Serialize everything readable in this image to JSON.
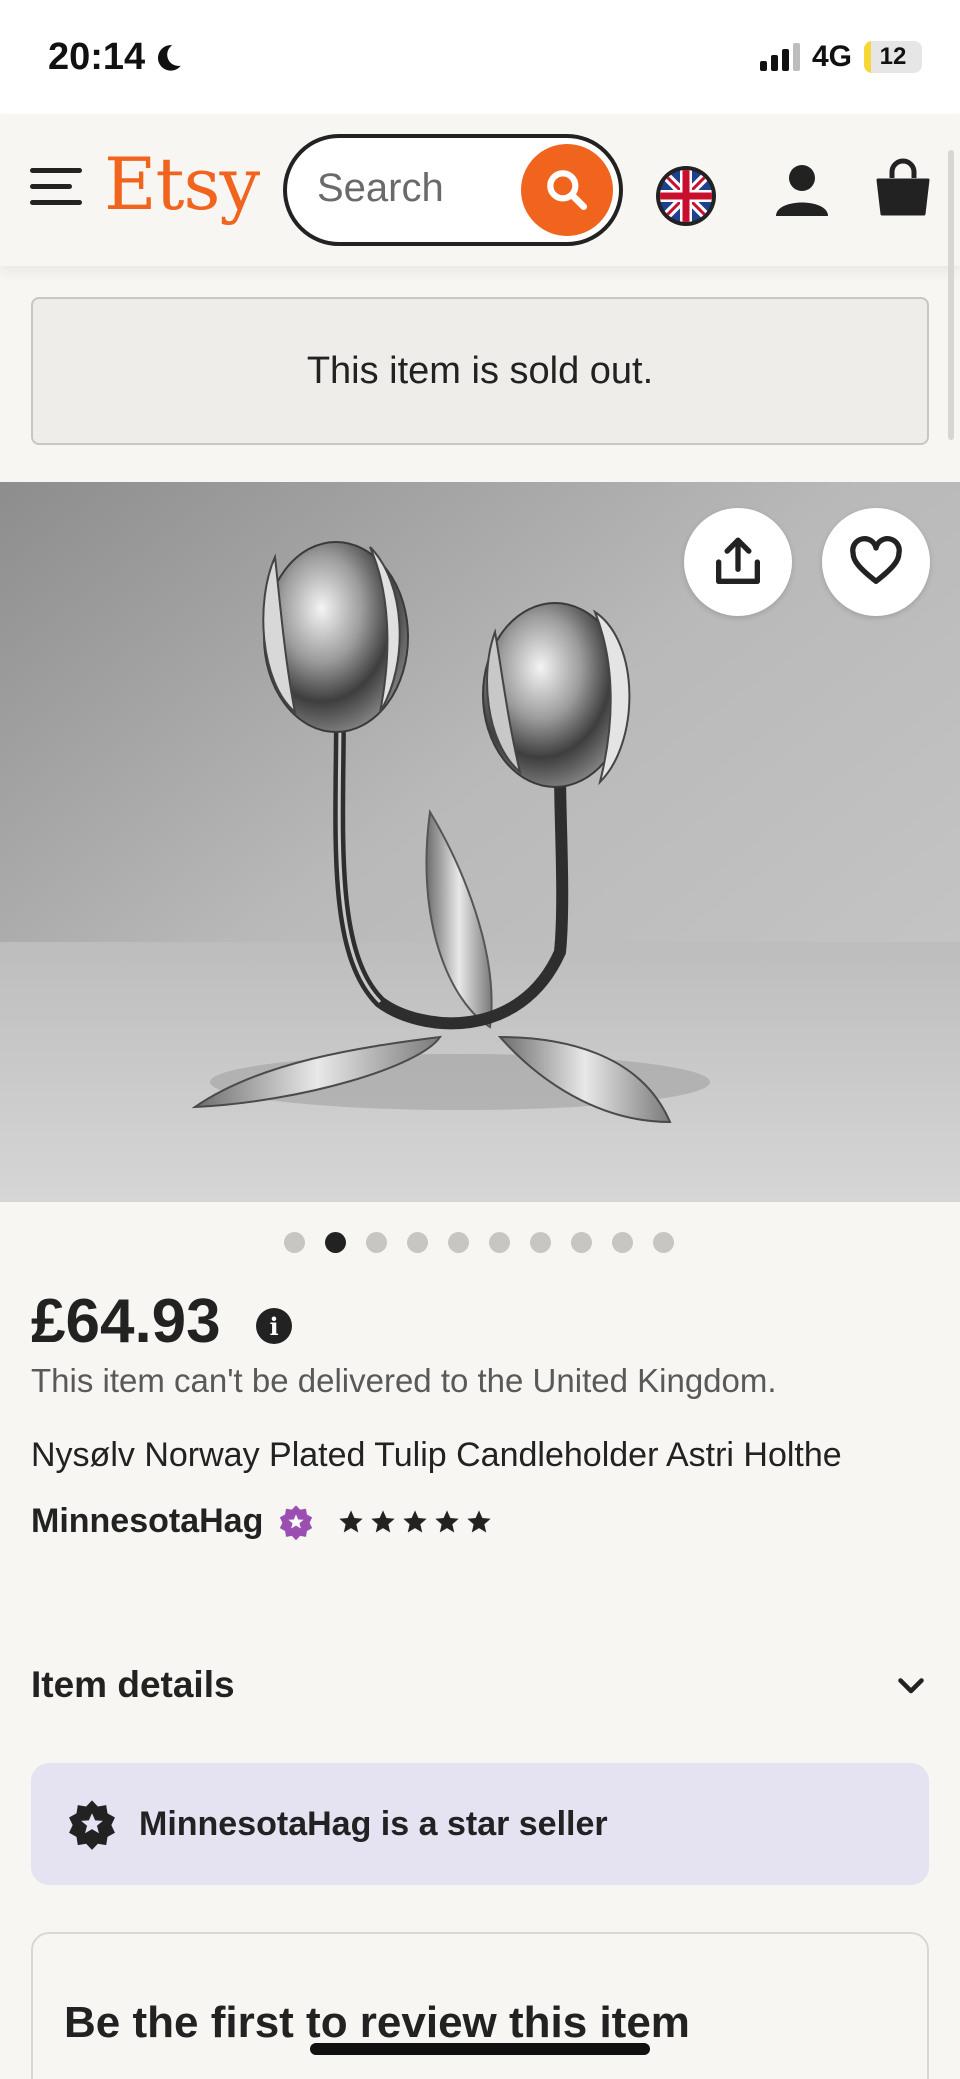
{
  "status_bar": {
    "time": "20:14",
    "network": "4G",
    "battery": "12",
    "battery_level": 0.12
  },
  "header": {
    "logo": "Etsy",
    "search_placeholder": "Search",
    "icons": [
      "hamburger-menu-icon",
      "search-icon",
      "uk-flag-icon",
      "user-icon",
      "cart-icon"
    ]
  },
  "banner": {
    "sold_out_text": "This item is sold out."
  },
  "gallery": {
    "image_count": 10,
    "active_index": 1,
    "actions": [
      "share-icon",
      "heart-icon"
    ]
  },
  "product": {
    "price": "£64.93",
    "delivery_note": "This item can't be delivered to the United Kingdom.",
    "title": "Nysølv Norway Plated Tulip Candleholder Astri Holthe",
    "seller": "MinnesotaHag",
    "rating_stars": 5
  },
  "sections": {
    "item_details_label": "Item details",
    "star_seller_text": "MinnesotaHag is a star seller",
    "review_heading": "Be the first to review this item"
  },
  "colors": {
    "brand_orange": "#f1641e",
    "star_seller_bg": "#e5e2f1",
    "badge_purple": "#9b4fb0"
  }
}
